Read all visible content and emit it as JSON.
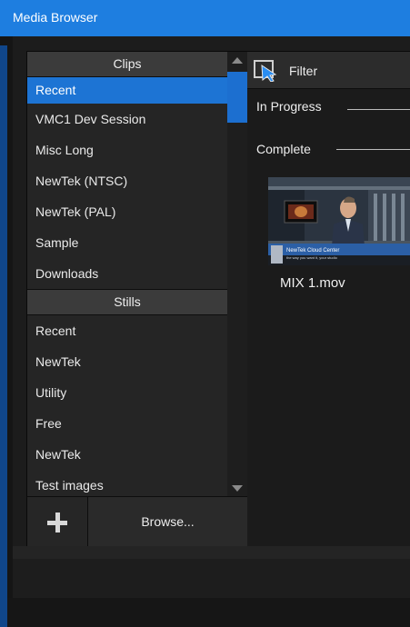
{
  "window": {
    "title": "Media Browser"
  },
  "clips": {
    "header": "Clips",
    "items": [
      "Recent",
      "VMC1 Dev Session",
      "Misc Long",
      "NewTek (NTSC)",
      "NewTek (PAL)",
      "Sample",
      "Downloads"
    ]
  },
  "stills": {
    "header": "Stills",
    "items": [
      "Recent",
      "NewTek",
      "Utility",
      "Free",
      "NewTek",
      "Test images"
    ]
  },
  "toolbar": {
    "browse_label": "Browse..."
  },
  "filter": {
    "label": "Filter"
  },
  "sections": {
    "in_progress": "In Progress",
    "complete": "Complete"
  },
  "clip": {
    "name": "MIX 1.mov",
    "lower_third_title": "NewTek Cloud Center",
    "lower_third_sub": "the way you want it, your studio"
  },
  "colors": {
    "accent": "#1d74d4",
    "titlebar": "#1e7ee0"
  }
}
